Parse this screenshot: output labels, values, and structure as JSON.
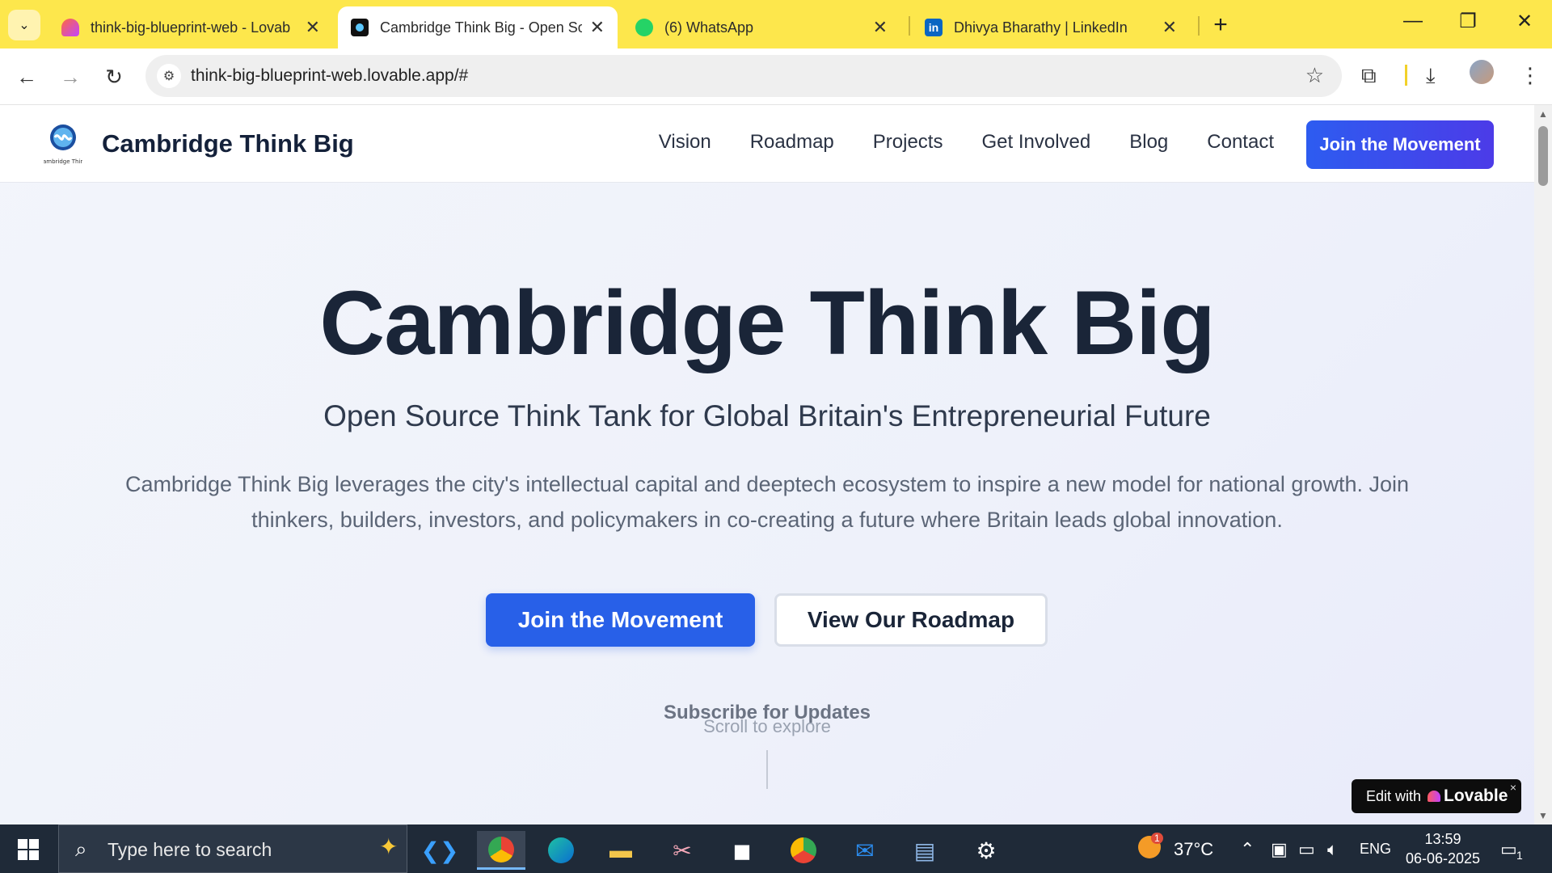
{
  "browser": {
    "tabs": [
      {
        "title": "think-big-blueprint-web - Lovab",
        "active": false
      },
      {
        "title": "Cambridge Think Big - Open Sou",
        "active": true
      },
      {
        "title": "(6) WhatsApp",
        "active": false
      },
      {
        "title": "Dhivya Bharathy | LinkedIn",
        "active": false
      }
    ],
    "new_tab": "+",
    "url": "think-big-blueprint-web.lovable.app/#",
    "window_controls": {
      "minimize": "—",
      "restore": "❐",
      "close": "✕"
    }
  },
  "site": {
    "brand": "Cambridge Think Big",
    "logo_text": "Cambridge Think",
    "nav": [
      "Vision",
      "Roadmap",
      "Projects",
      "Get Involved",
      "Blog",
      "Contact"
    ],
    "header_cta": "Join the Movement"
  },
  "hero": {
    "title": "Cambridge Think Big",
    "subtitle": "Open Source Think Tank for Global Britain's Entrepreneurial Future",
    "description": "Cambridge Think Big leverages the city's intellectual capital and deeptech ecosystem to inspire a new model for national growth. Join thinkers, builders, investors, and policymakers in co-creating a future where Britain leads global innovation.",
    "primary_button": "Join the Movement",
    "secondary_button": "View Our Roadmap",
    "subscribe": "Subscribe for Updates",
    "scroll_hint": "Scroll to explore"
  },
  "badge": {
    "prefix": "Edit with",
    "name": "Lovable",
    "close": "×"
  },
  "taskbar": {
    "search_placeholder": "Type here to search",
    "weather": "37°C",
    "weather_badge": "1",
    "language": "ENG",
    "time": "13:59",
    "date": "06-06-2025",
    "notifications": "1"
  },
  "colors": {
    "tabbar": "#fde74c",
    "primary": "#2860e8",
    "heading": "#1a2538",
    "taskbar": "#1f2a38"
  }
}
